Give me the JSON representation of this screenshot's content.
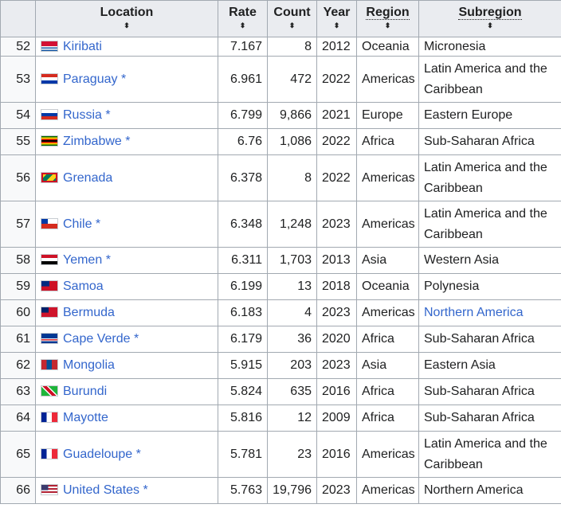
{
  "table": {
    "headers": {
      "location": "Location",
      "rate": "Rate",
      "count": "Count",
      "year": "Year",
      "region": "Region",
      "subregion": "Subregion"
    },
    "sort_glyph": "⬍",
    "rows": [
      {
        "rank": "52",
        "location": "Kiribati",
        "star": "",
        "rate": "7.167",
        "count": "8",
        "year": "2012",
        "region": "Oceania",
        "subregion": "Micronesia",
        "flag": "kiribati-flag-icon"
      },
      {
        "rank": "53",
        "location": "Paraguay",
        "star": "*",
        "rate": "6.961",
        "count": "472",
        "year": "2022",
        "region": "Americas",
        "subregion": "Latin America and the Caribbean",
        "flag": "paraguay-flag-icon"
      },
      {
        "rank": "54",
        "location": "Russia",
        "star": "*",
        "rate": "6.799",
        "count": "9,866",
        "year": "2021",
        "region": "Europe",
        "subregion": "Eastern Europe",
        "flag": "russia-flag-icon"
      },
      {
        "rank": "55",
        "location": "Zimbabwe",
        "star": "*",
        "rate": "6.76",
        "count": "1,086",
        "year": "2022",
        "region": "Africa",
        "subregion": "Sub-Saharan Africa",
        "flag": "zimbabwe-flag-icon"
      },
      {
        "rank": "56",
        "location": "Grenada",
        "star": "",
        "rate": "6.378",
        "count": "8",
        "year": "2022",
        "region": "Americas",
        "subregion": "Latin America and the Caribbean",
        "flag": "grenada-flag-icon"
      },
      {
        "rank": "57",
        "location": "Chile",
        "star": "*",
        "rate": "6.348",
        "count": "1,248",
        "year": "2023",
        "region": "Americas",
        "subregion": "Latin America and the Caribbean",
        "flag": "chile-flag-icon"
      },
      {
        "rank": "58",
        "location": "Yemen",
        "star": "*",
        "rate": "6.311",
        "count": "1,703",
        "year": "2013",
        "region": "Asia",
        "subregion": "Western Asia",
        "flag": "yemen-flag-icon"
      },
      {
        "rank": "59",
        "location": "Samoa",
        "star": "",
        "rate": "6.199",
        "count": "13",
        "year": "2018",
        "region": "Oceania",
        "subregion": "Polynesia",
        "flag": "samoa-flag-icon"
      },
      {
        "rank": "60",
        "location": "Bermuda",
        "star": "",
        "rate": "6.183",
        "count": "4",
        "year": "2023",
        "region": "Americas",
        "subregion": "Northern America",
        "subregion_link": true,
        "flag": "bermuda-flag-icon"
      },
      {
        "rank": "61",
        "location": "Cape Verde",
        "star": "*",
        "rate": "6.179",
        "count": "36",
        "year": "2020",
        "region": "Africa",
        "subregion": "Sub-Saharan Africa",
        "flag": "cape-verde-flag-icon"
      },
      {
        "rank": "62",
        "location": "Mongolia",
        "star": "",
        "rate": "5.915",
        "count": "203",
        "year": "2023",
        "region": "Asia",
        "subregion": "Eastern Asia",
        "flag": "mongolia-flag-icon"
      },
      {
        "rank": "63",
        "location": "Burundi",
        "star": "",
        "rate": "5.824",
        "count": "635",
        "year": "2016",
        "region": "Africa",
        "subregion": "Sub-Saharan Africa",
        "flag": "burundi-flag-icon"
      },
      {
        "rank": "64",
        "location": "Mayotte",
        "star": "",
        "rate": "5.816",
        "count": "12",
        "year": "2009",
        "region": "Africa",
        "subregion": "Sub-Saharan Africa",
        "flag": "mayotte-flag-icon"
      },
      {
        "rank": "65",
        "location": "Guadeloupe",
        "star": "*",
        "rate": "5.781",
        "count": "23",
        "year": "2016",
        "region": "Americas",
        "subregion": "Latin America and the Caribbean",
        "flag": "guadeloupe-flag-icon"
      },
      {
        "rank": "66",
        "location": "United States",
        "star": "*",
        "rate": "5.763",
        "count": "19,796",
        "year": "2023",
        "region": "Americas",
        "subregion": "Northern America",
        "flag": "united-states-flag-icon"
      }
    ]
  },
  "colors": {
    "link": "#3366cc",
    "header_bg": "#eaecf0",
    "rank_bg": "#f8f9fa",
    "border": "#a2a9b1"
  }
}
